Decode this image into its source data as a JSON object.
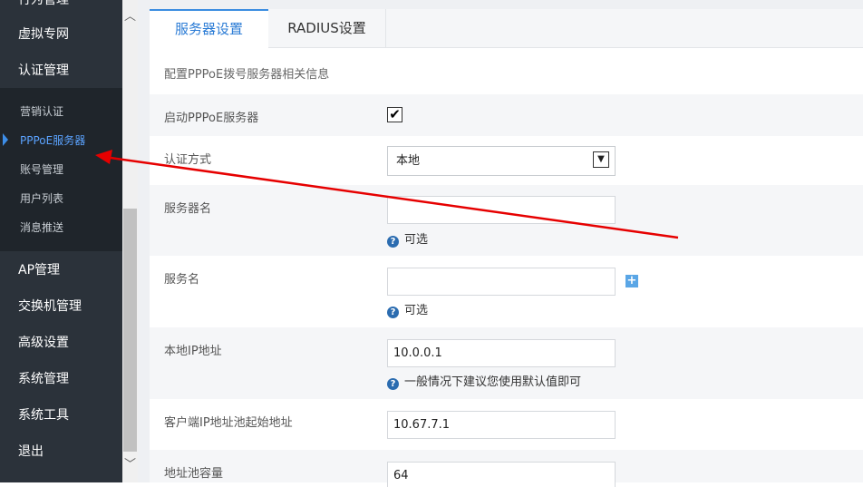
{
  "sidebar": {
    "top_items": [
      "行为管理",
      "虚拟专网",
      "认证管理"
    ],
    "sub_items": [
      "营销认证",
      "PPPoE服务器",
      "账号管理",
      "用户列表",
      "消息推送"
    ],
    "bottom_items": [
      "AP管理",
      "交换机管理",
      "高级设置",
      "系统管理",
      "系统工具",
      "退出"
    ]
  },
  "scrollbar": {
    "up": "︿",
    "down": "﹀"
  },
  "tabs": [
    "服务器设置",
    "RADIUS设置"
  ],
  "description": "配置PPPoE拨号服务器相关信息",
  "form": {
    "enable": {
      "label": "启动PPPoE服务器",
      "checked": "✔"
    },
    "auth": {
      "label": "认证方式",
      "value": "本地",
      "arrow": "▼"
    },
    "server_name": {
      "label": "服务器名",
      "value": "",
      "hint": "可选"
    },
    "service_name": {
      "label": "服务名",
      "value": "",
      "hint": "可选",
      "add": "+"
    },
    "local_ip": {
      "label": "本地IP地址",
      "value": "10.0.0.1",
      "hint": "一般情况下建议您使用默认值即可"
    },
    "pool_start": {
      "label": "客户端IP地址池起始地址",
      "value": "10.67.7.1"
    },
    "pool_size": {
      "label": "地址池容量",
      "value": "64"
    }
  },
  "hint_icon": "?",
  "colors": {
    "sidebar": "#2b323a",
    "accent": "#2a7bd5",
    "annotation_arrow": "#e60000"
  }
}
